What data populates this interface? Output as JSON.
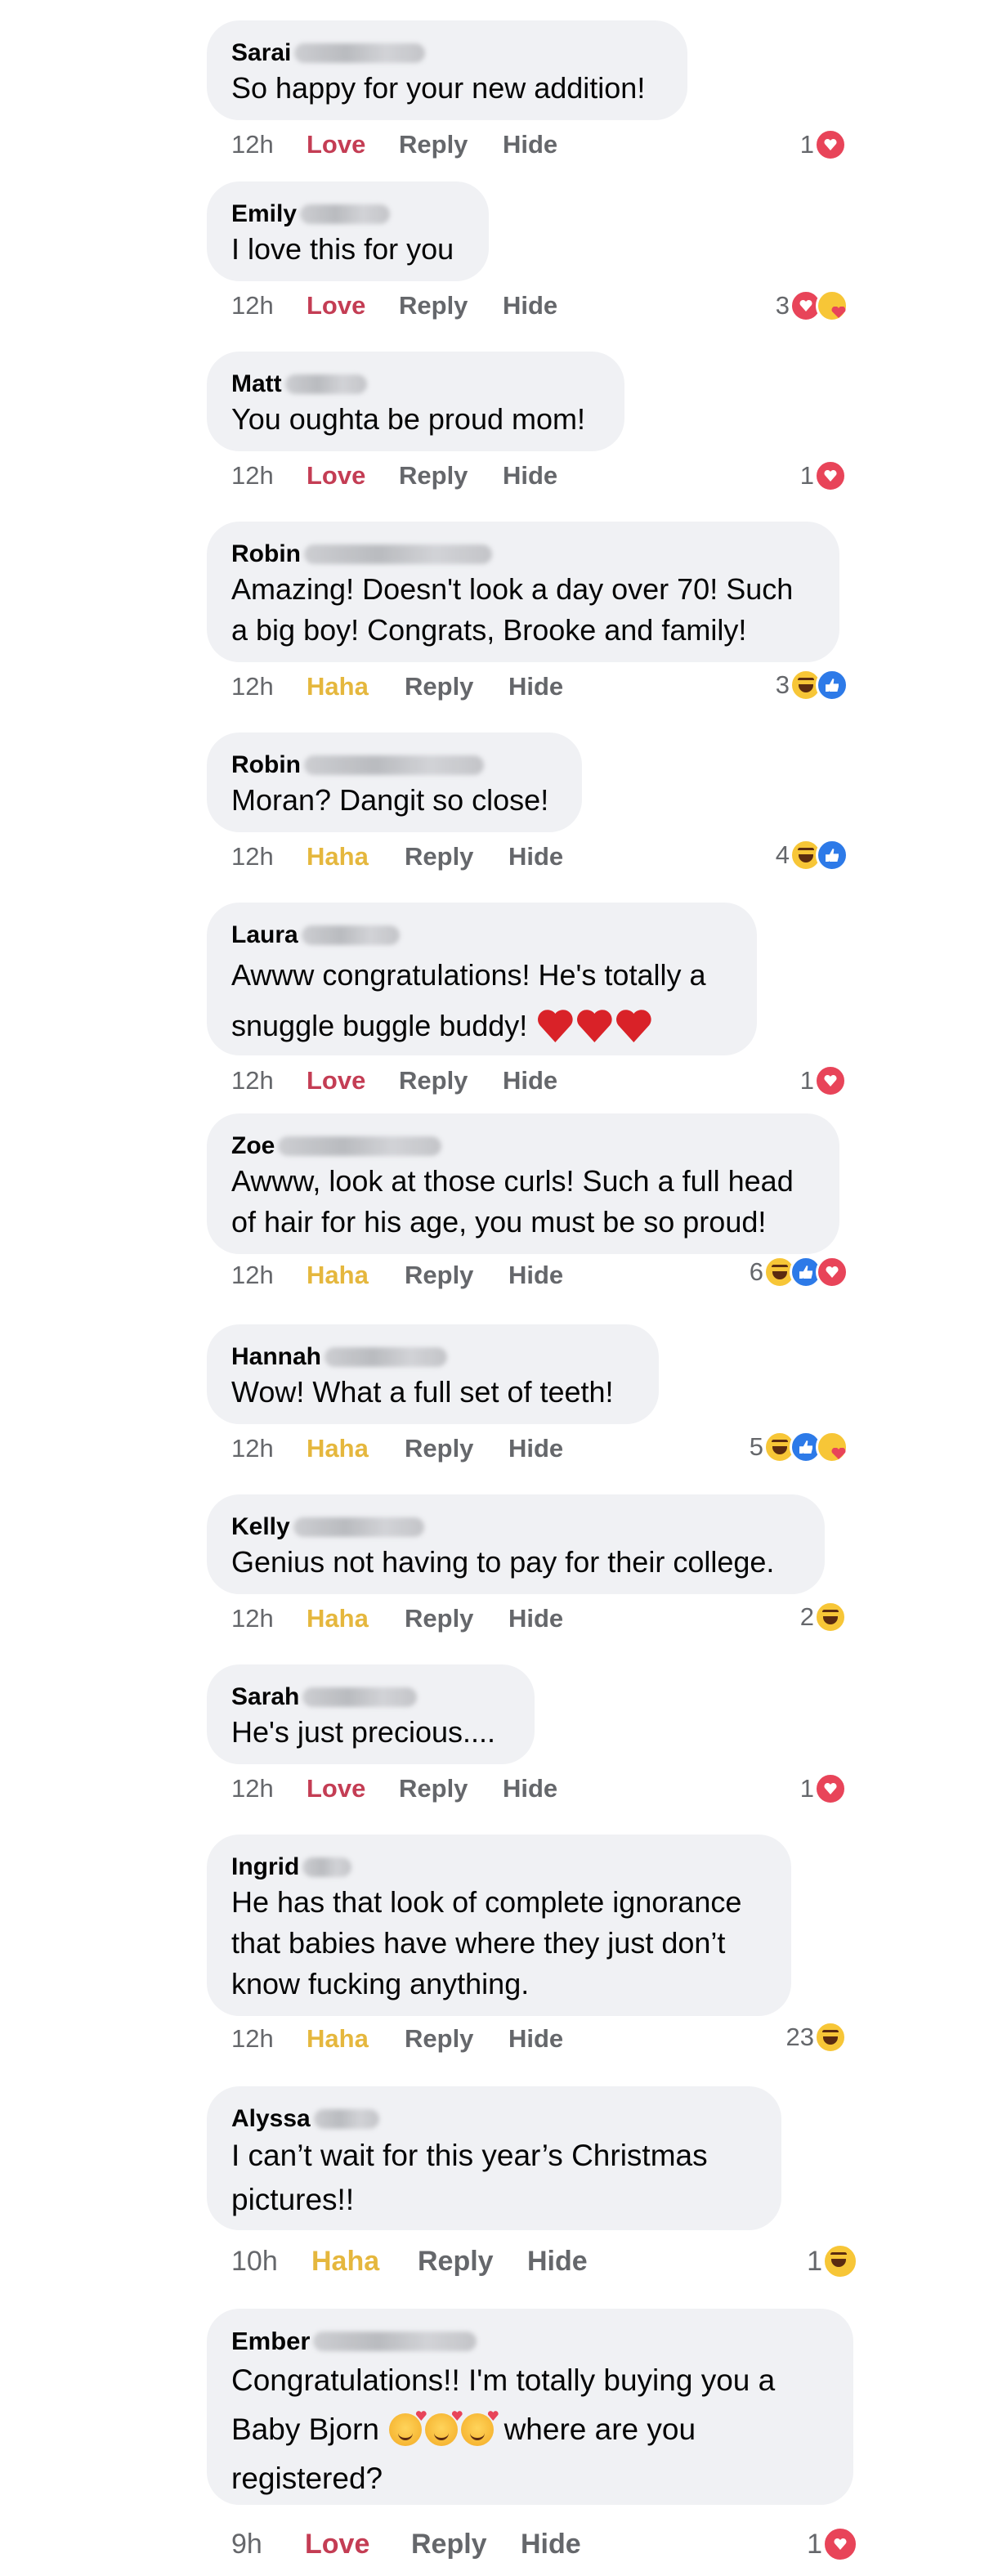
{
  "comments": [
    {
      "author": "Sarai",
      "text": "So happy for your new addition!",
      "time": "12h",
      "reaction_label": "Love",
      "reaction_kind": "love",
      "reply_label": "Reply",
      "hide_label": "Hide",
      "reaction_count": "1",
      "reaction_icons": [
        "heart-icon"
      ]
    },
    {
      "author": "Emily",
      "text": "I love this for you",
      "time": "12h",
      "reaction_label": "Love",
      "reaction_kind": "love",
      "reply_label": "Reply",
      "hide_label": "Hide",
      "reaction_count": "3",
      "reaction_icons": [
        "heart-icon",
        "care-icon"
      ]
    },
    {
      "author": "Matt",
      "text": "You oughta be proud mom!",
      "time": "12h",
      "reaction_label": "Love",
      "reaction_kind": "love",
      "reply_label": "Reply",
      "hide_label": "Hide",
      "reaction_count": "1",
      "reaction_icons": [
        "heart-icon"
      ]
    },
    {
      "author": "Robin",
      "text": "Amazing! Doesn't look a day over 70! Such a big boy! Congrats, Brooke and family!",
      "time": "12h",
      "reaction_label": "Haha",
      "reaction_kind": "haha",
      "reply_label": "Reply",
      "hide_label": "Hide",
      "reaction_count": "3",
      "reaction_icons": [
        "laugh-icon",
        "like-icon"
      ]
    },
    {
      "author": "Robin",
      "text": "Moran? Dangit so close!",
      "time": "12h",
      "reaction_label": "Haha",
      "reaction_kind": "haha",
      "reply_label": "Reply",
      "hide_label": "Hide",
      "reaction_count": "4",
      "reaction_icons": [
        "laugh-icon",
        "like-icon"
      ]
    },
    {
      "author": "Laura",
      "text": "Awww congratulations! He's totally a snuggle buggle buddy!",
      "time": "12h",
      "reaction_label": "Love",
      "reaction_kind": "love",
      "reply_label": "Reply",
      "hide_label": "Hide",
      "reaction_count": "1",
      "reaction_icons": [
        "heart-icon"
      ]
    },
    {
      "author": "Zoe",
      "text": "Awww, look at those curls! Such a full head of hair for his age, you must be so proud!",
      "time": "12h",
      "reaction_label": "Haha",
      "reaction_kind": "haha",
      "reply_label": "Reply",
      "hide_label": "Hide",
      "reaction_count": "6",
      "reaction_icons": [
        "laugh-icon",
        "like-icon",
        "heart-icon"
      ]
    },
    {
      "author": "Hannah",
      "text": "Wow! What a full set of teeth!",
      "time": "12h",
      "reaction_label": "Haha",
      "reaction_kind": "haha",
      "reply_label": "Reply",
      "hide_label": "Hide",
      "reaction_count": "5",
      "reaction_icons": [
        "laugh-icon",
        "like-icon",
        "care-icon"
      ]
    },
    {
      "author": "Kelly",
      "text": "Genius not having to pay for their college.",
      "time": "12h",
      "reaction_label": "Haha",
      "reaction_kind": "haha",
      "reply_label": "Reply",
      "hide_label": "Hide",
      "reaction_count": "2",
      "reaction_icons": [
        "laugh-icon"
      ]
    },
    {
      "author": "Sarah",
      "text": "He's just precious....",
      "time": "12h",
      "reaction_label": "Love",
      "reaction_kind": "love",
      "reply_label": "Reply",
      "hide_label": "Hide",
      "reaction_count": "1",
      "reaction_icons": [
        "heart-icon"
      ]
    },
    {
      "author": "Ingrid",
      "text": "He has that look of complete ignorance that babies have where they just don’t know fucking anything.",
      "time": "12h",
      "reaction_label": "Haha",
      "reaction_kind": "haha",
      "reply_label": "Reply",
      "hide_label": "Hide",
      "reaction_count": "23",
      "reaction_icons": [
        "laugh-icon"
      ]
    },
    {
      "author": "Alyssa",
      "text": "I can’t wait for this year’s Christmas pictures!!",
      "time": "10h",
      "reaction_label": "Haha",
      "reaction_kind": "haha",
      "reply_label": "Reply",
      "hide_label": "Hide",
      "reaction_count": "1",
      "reaction_icons": [
        "laugh-icon"
      ]
    },
    {
      "author": "Ember",
      "text_before": "Congratulations!! I'm totally buying you a Baby Bjorn",
      "text_after": "where are you registered?",
      "time": "9h",
      "reaction_label": "Love",
      "reaction_kind": "love",
      "reply_label": "Reply",
      "hide_label": "Hide",
      "reaction_count": "1",
      "reaction_icons": [
        "heart-icon"
      ]
    }
  ],
  "colors": {
    "bubble": "#f0f1f4",
    "love": "#c43d54",
    "haha": "#e5b73d",
    "meta": "#65676b",
    "heart": "#e84459",
    "like": "#2d7ae8",
    "laugh": "#f7c637"
  }
}
